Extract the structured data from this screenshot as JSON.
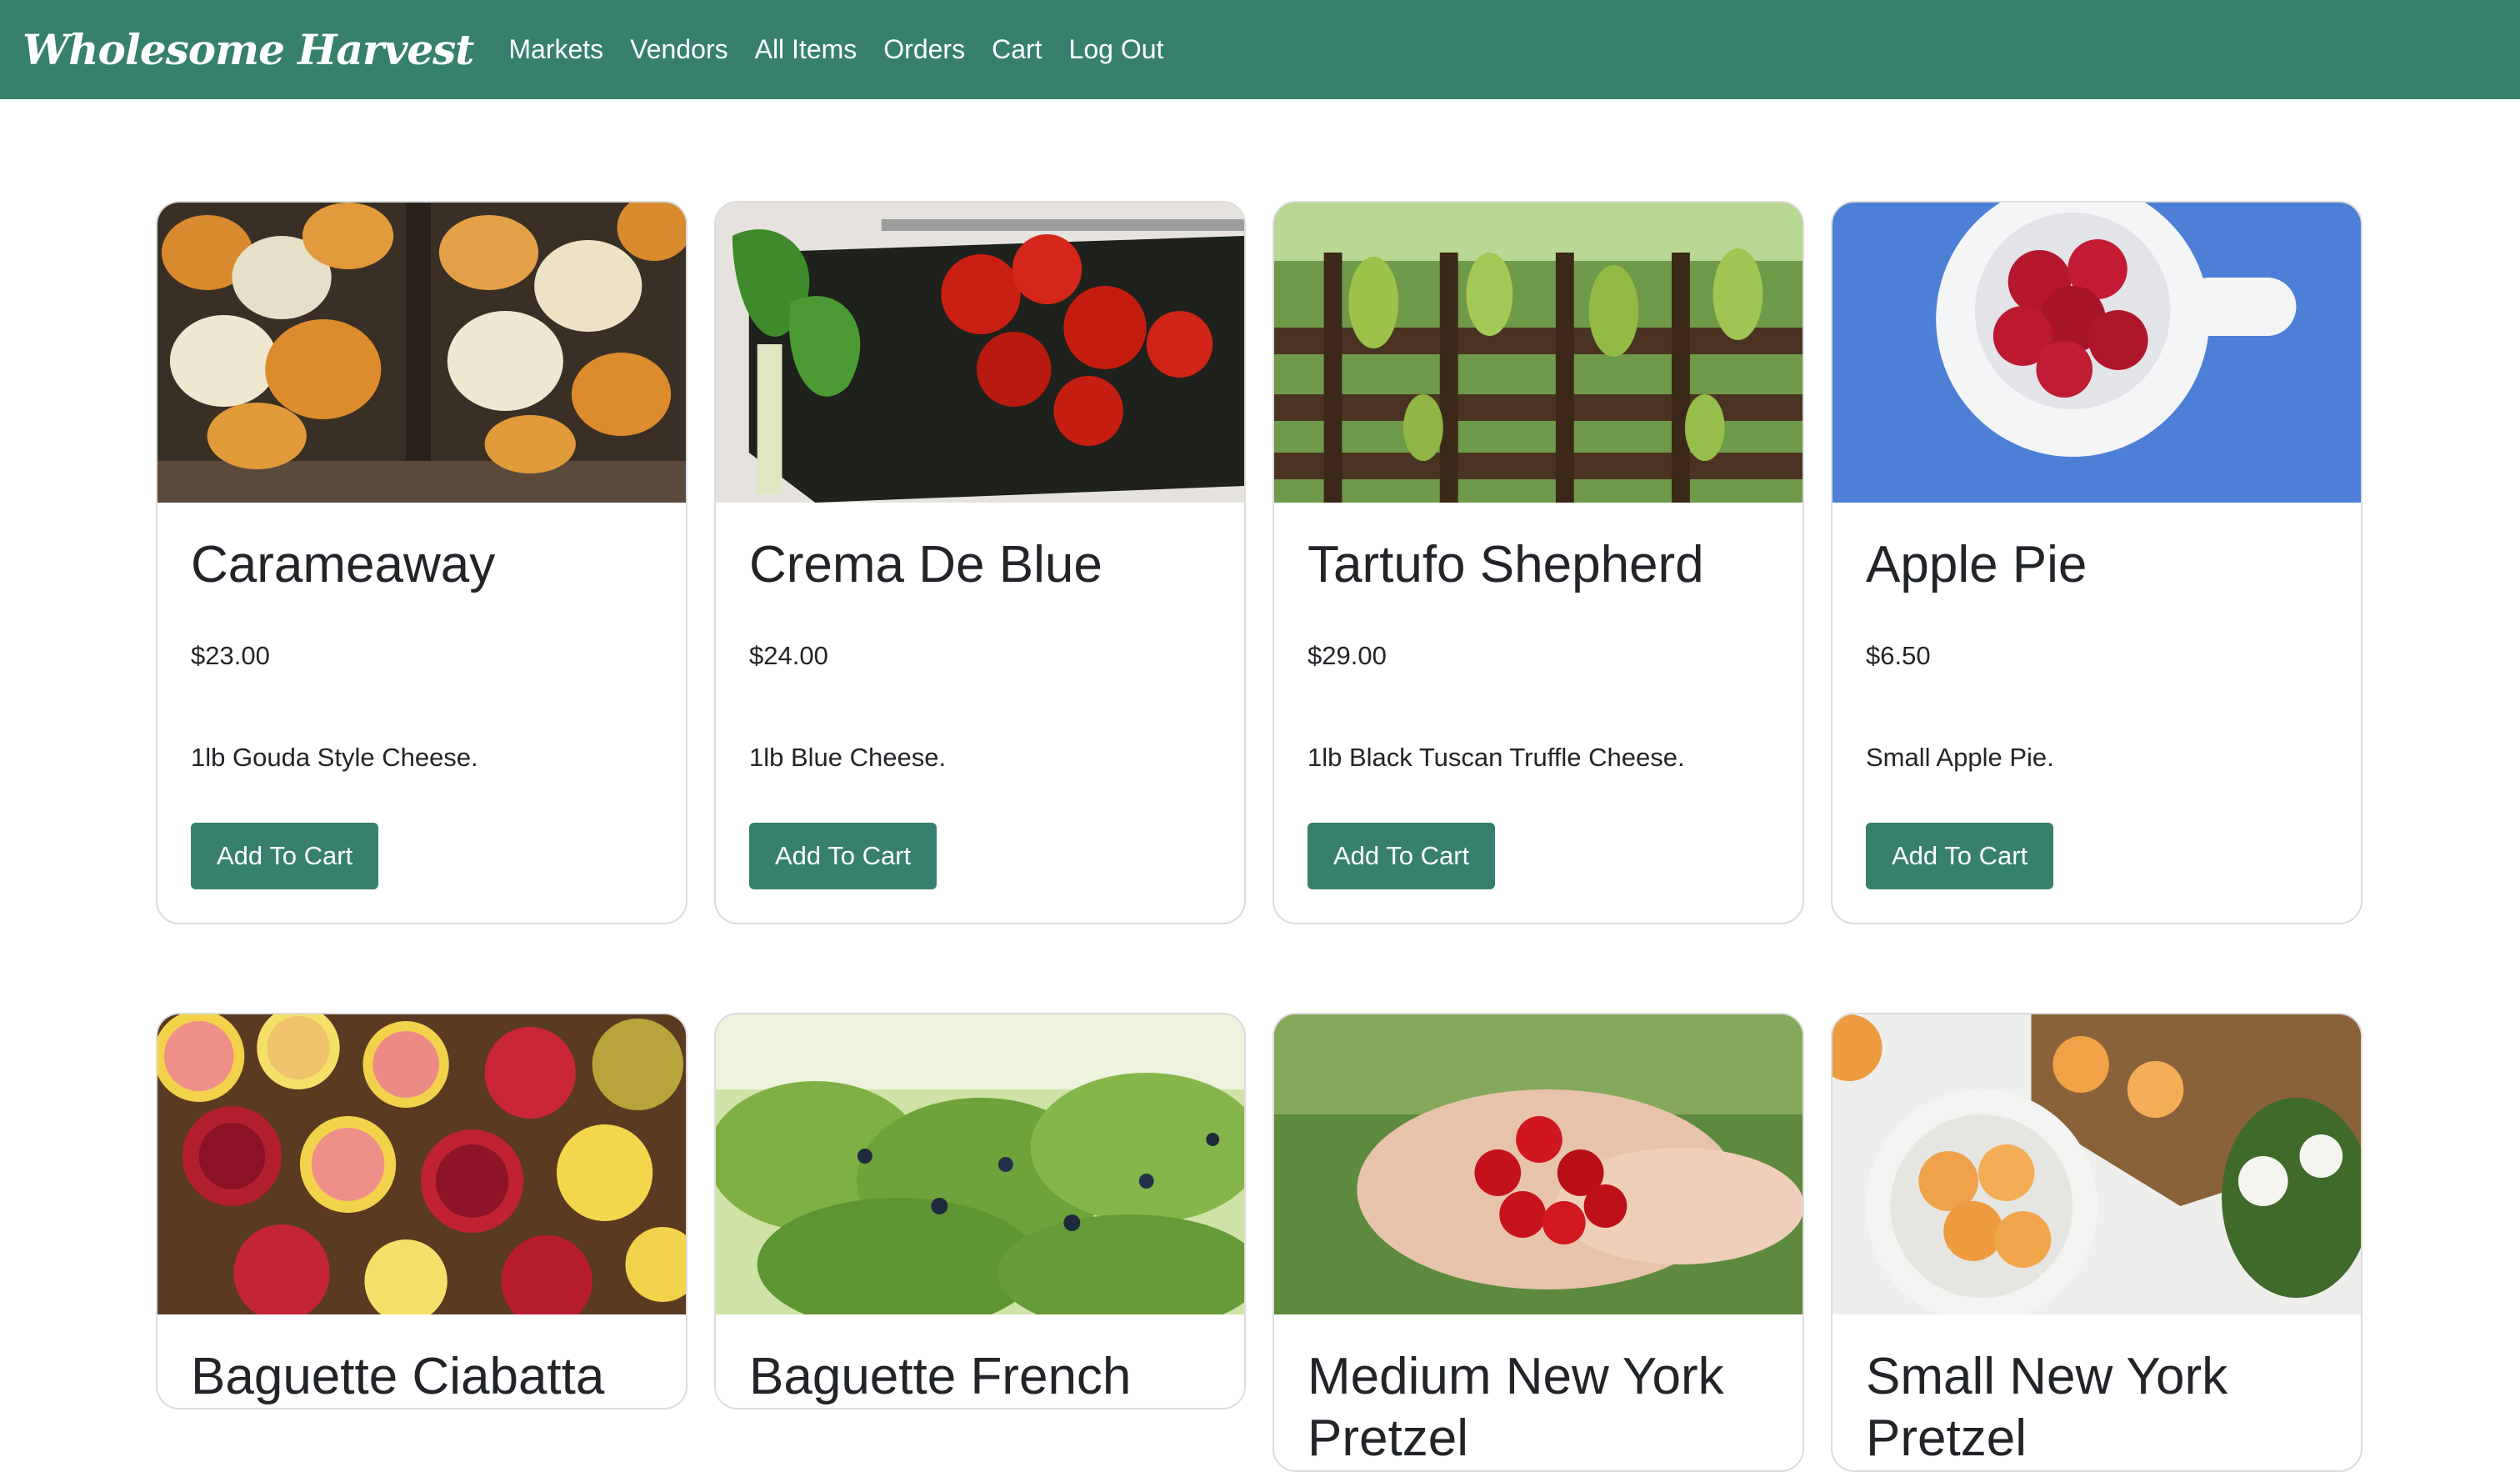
{
  "brand": "Wholesome Harvest",
  "nav": [
    "Markets",
    "Vendors",
    "All Items",
    "Orders",
    "Cart",
    "Log Out"
  ],
  "items": [
    {
      "name": "Carameaway",
      "price": "$23.00",
      "desc": "1lb Gouda Style Cheese.",
      "button": "Add To Cart",
      "image": "pumpkins-photo"
    },
    {
      "name": "Crema De Blue",
      "price": "$24.00",
      "desc": "1lb Blue Cheese.",
      "button": "Add To Cart",
      "image": "tomatoes-photo"
    },
    {
      "name": "Tartufo Shepherd",
      "price": "$29.00",
      "desc": "1lb Black Tuscan Truffle Cheese.",
      "button": "Add To Cart",
      "image": "grapevine-photo"
    },
    {
      "name": "Apple Pie",
      "price": "$6.50",
      "desc": "Small Apple Pie.",
      "button": "Add To Cart",
      "image": "raspberries-photo"
    },
    {
      "name": "Baguette Ciabatta",
      "image": "citrus-pomegranate-photo"
    },
    {
      "name": "Baguette French",
      "image": "blueberry-bush-photo"
    },
    {
      "name": "Medium New York Pretzel",
      "image": "cherries-hands-photo"
    },
    {
      "name": "Small New York Pretzel",
      "image": "apricots-photo"
    }
  ]
}
